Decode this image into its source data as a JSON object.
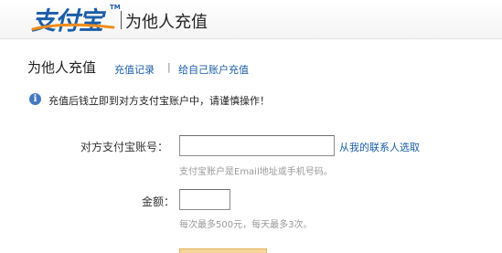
{
  "header": {
    "logo_text": "支付宝",
    "logo_tm": "TM",
    "title": "为他人充值"
  },
  "page": {
    "title": "为他人充值",
    "nav": {
      "records_label": "充值记录",
      "separator": "|",
      "self_topup_label": "给自己账户充值"
    },
    "notice": {
      "icon": "info-icon",
      "icon_glyph": "i",
      "text": "充值后钱立即到对方支付宝账户中，请谨慎操作！"
    }
  },
  "form": {
    "account": {
      "label": "对方支付宝账号：",
      "value": "",
      "contacts_link": "从我的联系人选取",
      "hint": "支付宝账户是Email地址或手机号码。"
    },
    "amount": {
      "label": "金额：",
      "value": "",
      "hint": "每次最多500元，每天最多3次。"
    }
  },
  "colors": {
    "brand": "#1a5ea8",
    "link": "#1a5ea8",
    "hint": "#999999",
    "info_icon": "#4479c2"
  }
}
